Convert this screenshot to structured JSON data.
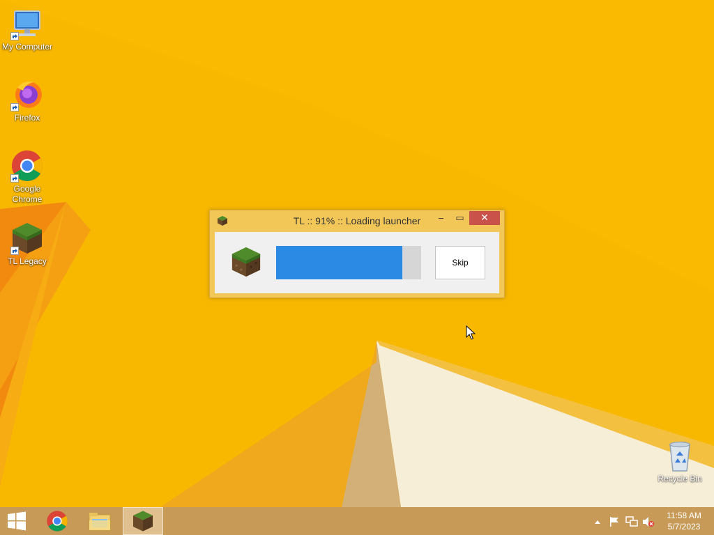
{
  "desktop": {
    "icons": [
      {
        "label": "My Computer",
        "icon": "computer-icon"
      },
      {
        "label": "Firefox",
        "icon": "firefox-icon"
      },
      {
        "label": "Google Chrome",
        "icon": "chrome-icon"
      },
      {
        "label": "TL Legacy",
        "icon": "grass-block-icon"
      },
      {
        "label": "Recycle Bin",
        "icon": "recycle-bin-icon"
      }
    ]
  },
  "dialog": {
    "title": "TL :: 91% :: Loading launcher",
    "progress": 0.87,
    "skip_label": "Skip",
    "close_glyph": "✕",
    "minimize_glyph": "–",
    "maximize_glyph": "▭"
  },
  "taskbar": {
    "items": [
      "start-button",
      "chrome",
      "file-explorer",
      "tl-legacy"
    ],
    "clock": {
      "time": "11:58 AM",
      "date": "5/7/2023"
    }
  },
  "colors": {
    "wallpaper": "#f7b500",
    "progress_fill": "#2a8ae4",
    "close_button": "#c9524a"
  }
}
